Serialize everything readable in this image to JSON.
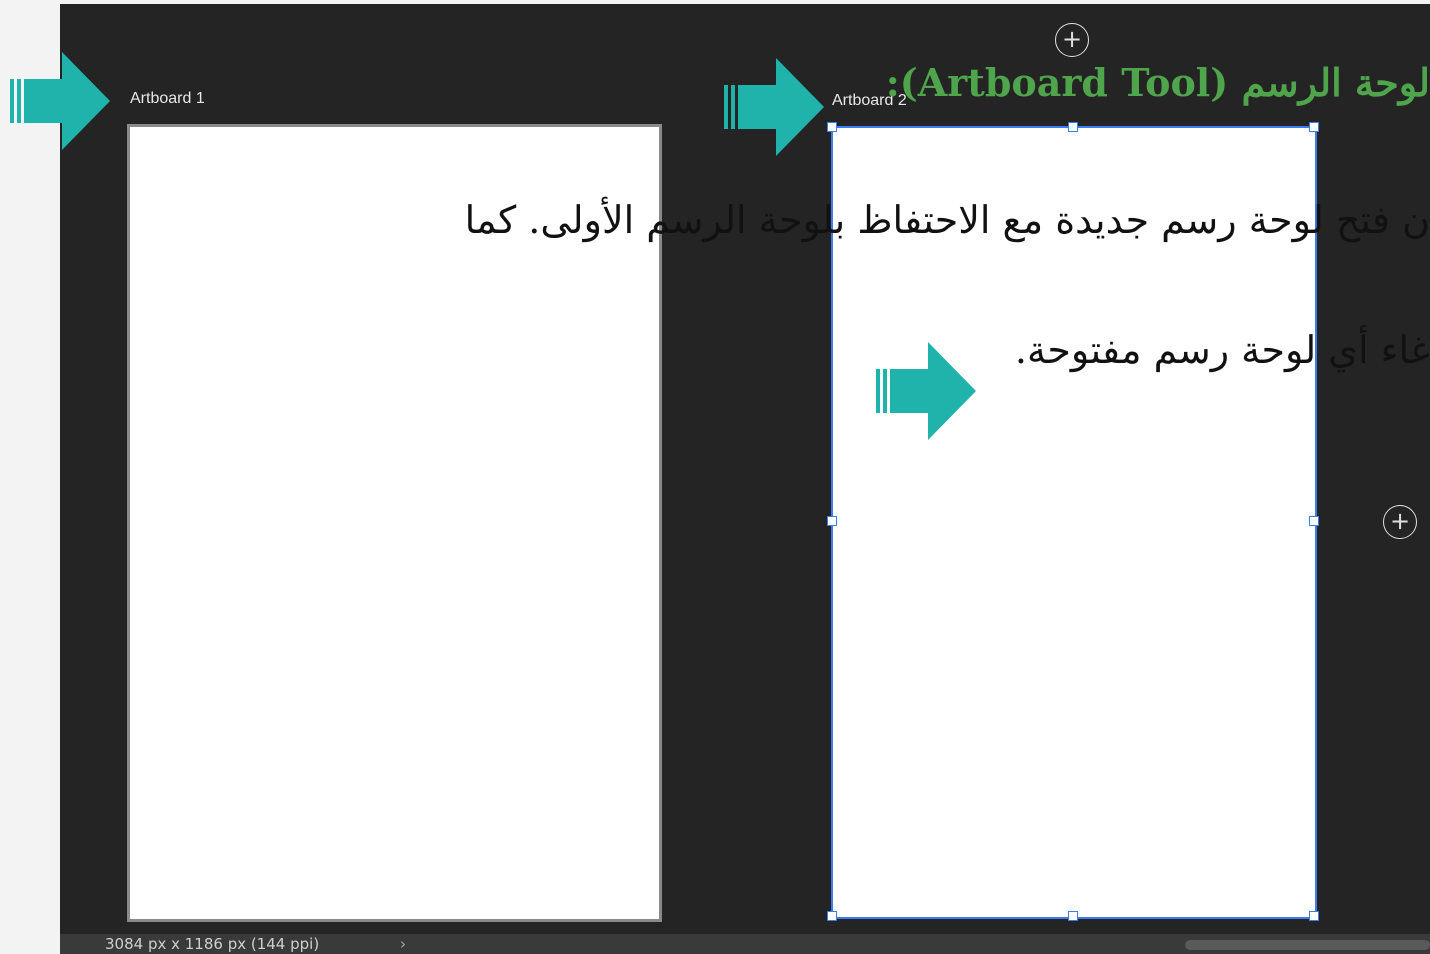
{
  "canvas": {
    "artboard1_label": "Artboard 1",
    "artboard2_label": "Artboard 2",
    "add_icon": "plus-circle-icon"
  },
  "statusbar": {
    "dimensions": "3084 px x 1186 px (144 ppi)",
    "chevron": "›"
  },
  "overlay": {
    "title": "لوحة الرسم (Artboard Tool):",
    "line1": "ن فتح لوحة رسم جديدة مع الاحتفاظ بلوحة الرسم الأولى. كما",
    "line2": "غاء أي لوحة رسم مفتوحة."
  },
  "colors": {
    "canvas_bg": "#242424",
    "selection": "#3d7bf0",
    "arrow": "#20b3ac",
    "title": "#4ea54b"
  }
}
